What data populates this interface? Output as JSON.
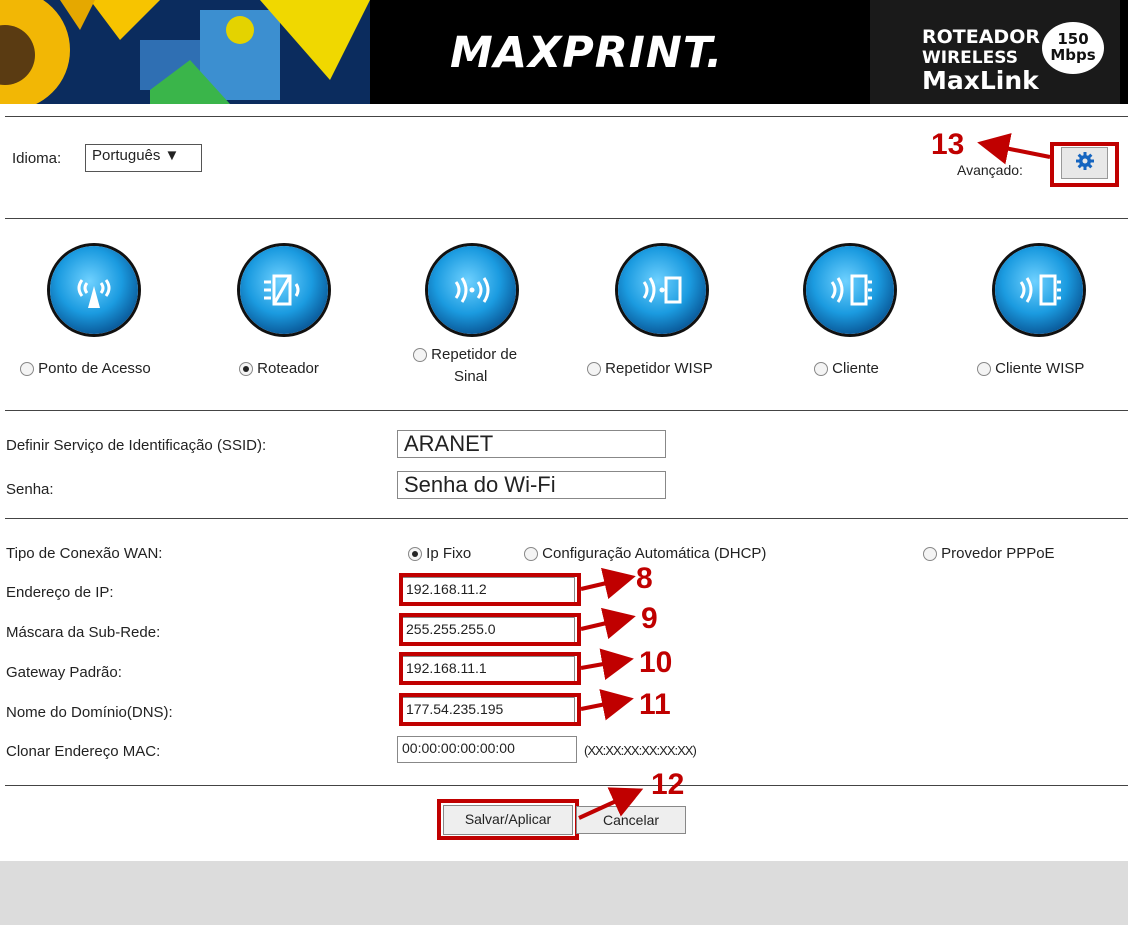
{
  "header": {
    "logo": "MAXPRINT.",
    "badge_line1": "ROTEADOR",
    "badge_line2": "WIRELESS",
    "badge_line3": "MaxLink",
    "speed_value": "150",
    "speed_unit": "Mbps"
  },
  "language": {
    "label": "Idioma:",
    "selected": "Português ▼"
  },
  "advanced": {
    "label": "Avançado:",
    "icon": "gear-icon"
  },
  "modes": [
    {
      "label": "Ponto de Acesso",
      "selected": false
    },
    {
      "label": "Roteador",
      "selected": true
    },
    {
      "label_line1": "Repetidor de",
      "label_line2": "Sinal",
      "selected": false
    },
    {
      "label": "Repetidor WISP",
      "selected": false
    },
    {
      "label": "Cliente",
      "selected": false
    },
    {
      "label": "Cliente WISP",
      "selected": false
    }
  ],
  "wifi": {
    "ssid_label": "Definir Serviço de Identificação (SSID):",
    "ssid_value": "ARANET",
    "password_label": "Senha:",
    "password_value": "Senha do Wi-Fi"
  },
  "wan": {
    "type_label": "Tipo de Conexão WAN:",
    "options": [
      {
        "label": "Ip Fixo",
        "selected": true
      },
      {
        "label": "Configuração Automática (DHCP)",
        "selected": false
      },
      {
        "label": "Provedor PPPoE",
        "selected": false
      }
    ],
    "ip_label": "Endereço de IP:",
    "ip_value": "192.168.11.2",
    "mask_label": "Máscara da Sub-Rede:",
    "mask_value": "255.255.255.0",
    "gateway_label": "Gateway Padrão:",
    "gateway_value": "192.168.11.1",
    "dns_label": "Nome do Domínio(DNS):",
    "dns_value": "177.54.235.195",
    "mac_label": "Clonar Endereço MAC:",
    "mac_value": "00:00:00:00:00:00",
    "mac_hint": "(XX:XX:XX:XX:XX:XX)"
  },
  "buttons": {
    "save": "Salvar/Aplicar",
    "cancel": "Cancelar"
  },
  "annotations": {
    "n8": "8",
    "n9": "9",
    "n10": "10",
    "n11": "11",
    "n12": "12",
    "n13": "13"
  },
  "colors": {
    "annotation_red": "#c00000",
    "gear_blue": "#1565c0"
  }
}
